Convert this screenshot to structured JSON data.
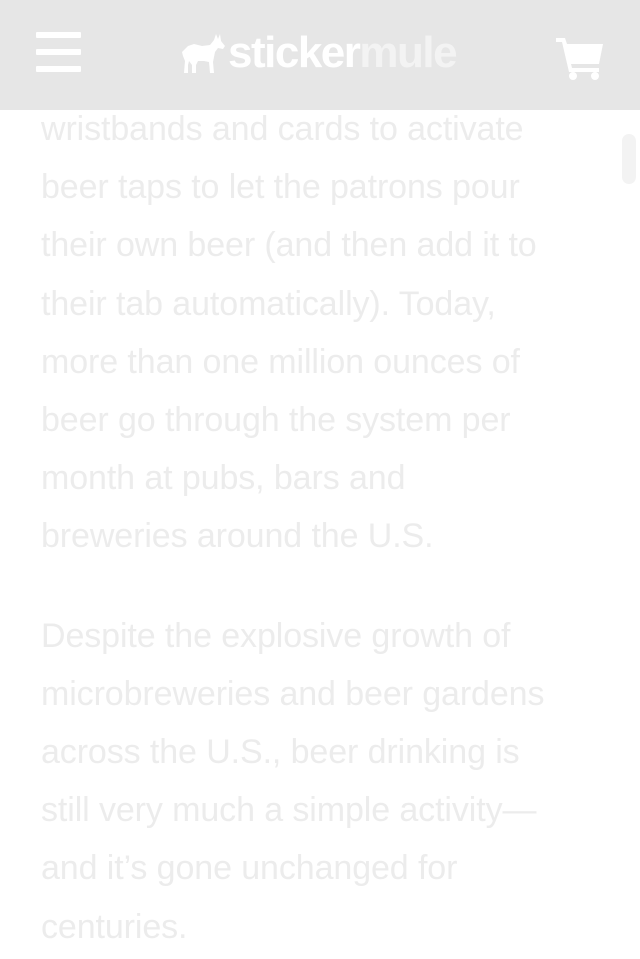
{
  "header": {
    "menu_icon": "hamburger-menu-icon",
    "logo": {
      "part1": "sticker",
      "part2": "mule",
      "icon": "mule-icon"
    },
    "cart_icon": "shopping-cart-icon"
  },
  "article": {
    "paragraphs": [
      {
        "lines": [
          "wristbands and cards to activate",
          "beer taps to let the patrons pour",
          "their own beer (and then add it to",
          "their tab automatically). Today,",
          "more than one million ounces of",
          "beer go through the system per",
          "month at pubs, bars and",
          "breweries around the U.S."
        ]
      },
      {
        "lines": [
          "Despite the explosive growth of",
          "microbreweries and beer gardens",
          "across the U.S., beer drinking is",
          "still very much a simple activity—",
          "and it’s gone unchanged for",
          "centuries."
        ]
      }
    ]
  },
  "colors": {
    "header_bg": "#e6e6e6",
    "icon_fill": "#ffffff",
    "body_text": "#ececec"
  }
}
